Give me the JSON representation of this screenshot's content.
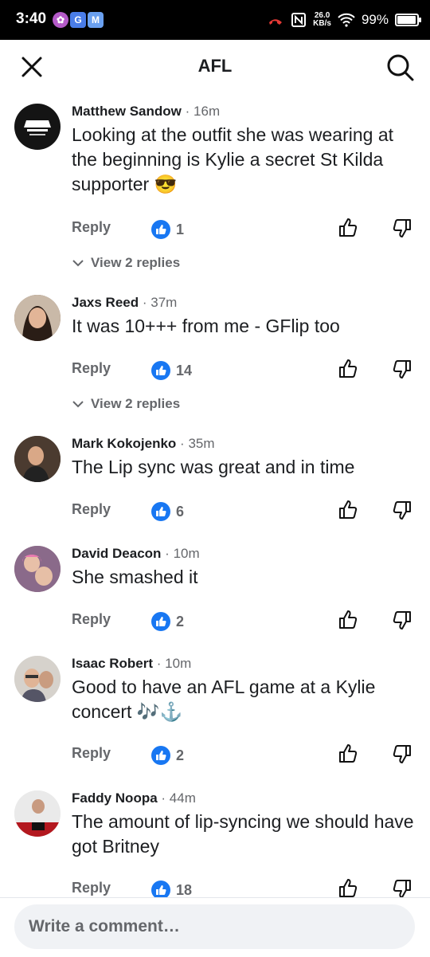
{
  "status_bar": {
    "time": "3:40",
    "app_icons": [
      "app-icon",
      "google-icon",
      "mail-icon"
    ],
    "speed": "26.0",
    "speed_unit": "KB/s",
    "battery": "99%"
  },
  "header": {
    "title": "AFL"
  },
  "comments": [
    {
      "name": "Matthew Sandow",
      "time": "16m",
      "text": "Looking at the outfit she was wearing at the beginning is Kylie a secret St Kilda supporter 😎",
      "reply_label": "Reply",
      "likes": "1",
      "view_replies": "View 2 replies"
    },
    {
      "name": "Jaxs Reed",
      "time": "37m",
      "text": "It was 10+++ from me  - GFlip too",
      "reply_label": "Reply",
      "likes": "14",
      "view_replies": "View 2 replies"
    },
    {
      "name": "Mark Kokojenko",
      "time": "35m",
      "text": "The Lip sync was great and in time",
      "reply_label": "Reply",
      "likes": "6"
    },
    {
      "name": "David Deacon",
      "time": "10m",
      "text": "She smashed it",
      "reply_label": "Reply",
      "likes": "2"
    },
    {
      "name": "Isaac Robert",
      "time": "10m",
      "text": "Good to have an AFL game at a Kylie concert 🎶⚓️",
      "reply_label": "Reply",
      "likes": "2"
    },
    {
      "name": "Faddy Noopa",
      "time": "44m",
      "text": "The amount of lip-syncing we should have got Britney",
      "reply_label": "Reply",
      "likes": "18"
    }
  ],
  "composer": {
    "placeholder": "Write a comment…"
  },
  "colors": {
    "accent": "#1877f2",
    "secondary_text": "#65676b",
    "composer_bg": "#f0f2f5"
  }
}
